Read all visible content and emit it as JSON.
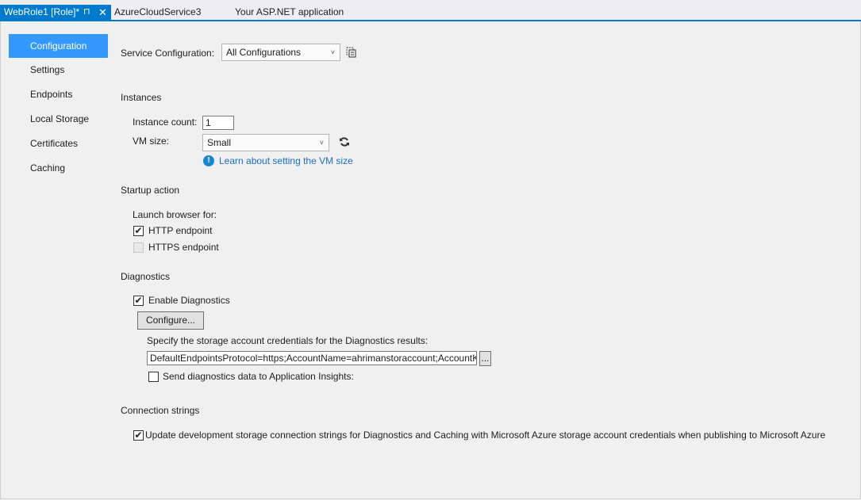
{
  "tabs": [
    {
      "label": "WebRole1 [Role]*",
      "pin": "⊓",
      "close": "✕"
    },
    {
      "label": "AzureCloudService3"
    },
    {
      "label": "Your ASP.NET application"
    }
  ],
  "nav": {
    "items": [
      "Configuration",
      "Settings",
      "Endpoints",
      "Local Storage",
      "Certificates",
      "Caching"
    ],
    "selected": "Configuration"
  },
  "service_configuration": {
    "label": "Service Configuration:",
    "value": "All Configurations"
  },
  "instances": {
    "heading": "Instances",
    "count_label": "Instance count:",
    "count_value": "1",
    "vm_size_label": "VM size:",
    "vm_size_value": "Small",
    "learn_link": "Learn about setting the VM size"
  },
  "startup": {
    "heading": "Startup action",
    "launch_label": "Launch browser for:",
    "http_label": "HTTP endpoint",
    "http_checked": true,
    "https_label": "HTTPS endpoint",
    "https_checked": false
  },
  "diagnostics": {
    "heading": "Diagnostics",
    "enable_label": "Enable Diagnostics",
    "enable_checked": true,
    "configure_button": "Configure...",
    "storage_label": "Specify the storage account credentials for the Diagnostics results:",
    "storage_value": "DefaultEndpointsProtocol=https;AccountName=ahrimanstoraccount;AccountKey",
    "browse_button": "...",
    "app_insights_label": "Send diagnostics data to Application Insights:",
    "app_insights_checked": false
  },
  "connection": {
    "heading": "Connection strings",
    "update_label": "Update development storage connection strings for Diagnostics and Caching with Microsoft Azure storage account credentials when publishing to Microsoft Azure",
    "update_checked": true
  },
  "glyphs": {
    "check": "✔",
    "dropdown": "˅",
    "info": "!"
  }
}
